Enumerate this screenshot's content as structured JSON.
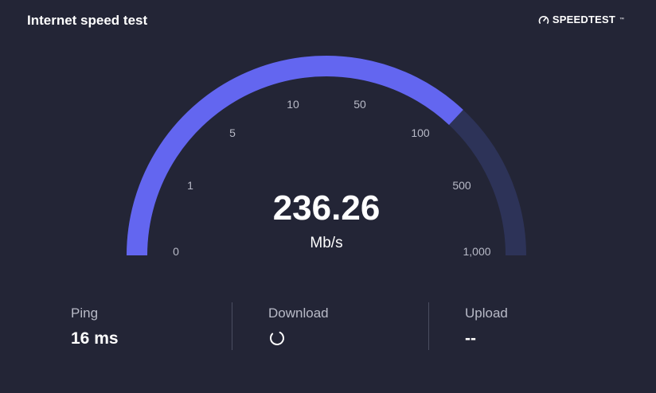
{
  "header": {
    "title": "Internet speed test",
    "brand": "SPEEDTEST",
    "brand_icon": "speedometer-icon"
  },
  "gauge": {
    "labels": [
      "0",
      "1",
      "5",
      "10",
      "50",
      "100",
      "500",
      "1,000"
    ],
    "fill_fraction": 0.74,
    "fill_color": "#6366f0",
    "track_color": "#2d3358"
  },
  "result": {
    "value": "236.26",
    "unit": "Mb/s"
  },
  "stats": {
    "ping_label": "Ping",
    "ping_value": "16 ms",
    "download_label": "Download",
    "download_icon": "loading-spinner-icon",
    "upload_label": "Upload",
    "upload_value": "--"
  }
}
